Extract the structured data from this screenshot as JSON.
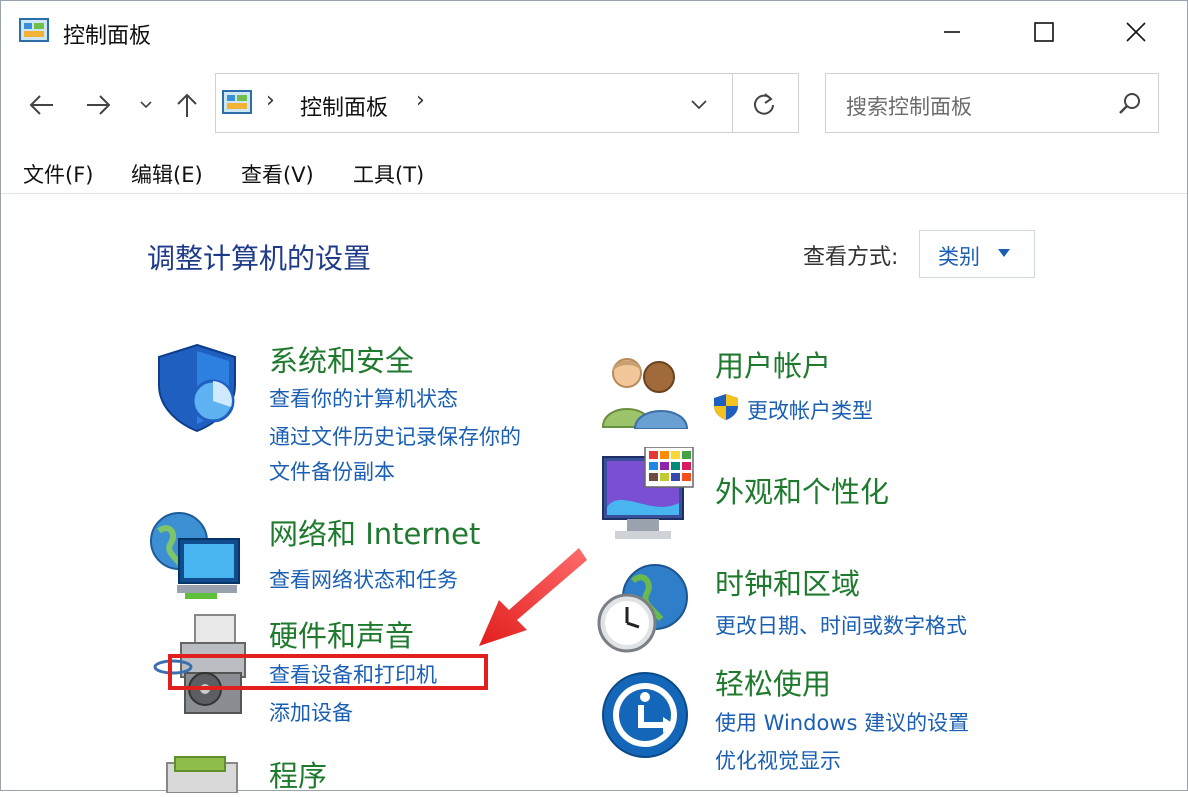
{
  "window": {
    "title": "控制面板",
    "icon": "control-panel-icon",
    "controls": [
      "minimize-icon",
      "maximize-icon",
      "close-icon"
    ]
  },
  "nav": {
    "back_icon": "back-arrow-icon",
    "forward_icon": "forward-arrow-icon",
    "recent_icon": "chevron-down-icon",
    "up_icon": "up-arrow-icon"
  },
  "address": {
    "separator": "›",
    "path": "控制面板",
    "trailing_separator": "›"
  },
  "search": {
    "placeholder": "搜索控制面板"
  },
  "menu": [
    "文件(F)",
    "编辑(E)",
    "查看(V)",
    "工具(T)"
  ],
  "main": {
    "title": "调整计算机的设置",
    "view_by_label": "查看方式:",
    "view_by_value": "类别"
  },
  "categories": {
    "system_security": {
      "title": "系统和安全",
      "links": [
        "查看你的计算机状态",
        "通过文件历史记录保存你的",
        "文件备份副本"
      ]
    },
    "network": {
      "title": "网络和 Internet",
      "links": [
        "查看网络状态和任务"
      ]
    },
    "hardware": {
      "title": "硬件和声音",
      "links": [
        "查看设备和打印机",
        "添加设备"
      ]
    },
    "programs": {
      "title": "程序"
    },
    "user_accounts": {
      "title": "用户帐户",
      "links": [
        "更改帐户类型"
      ]
    },
    "appearance": {
      "title": "外观和个性化"
    },
    "clock_region": {
      "title": "时钟和区域",
      "links": [
        "更改日期、时间或数字格式"
      ]
    },
    "ease_of_access": {
      "title": "轻松使用",
      "links": [
        "使用 Windows 建议的设置",
        "优化视觉显示"
      ]
    }
  },
  "colors": {
    "category_title": "#1f7a2e",
    "link": "#1a5fb4",
    "page_title": "#1e3a8a",
    "annotation": "#e21e1e"
  }
}
